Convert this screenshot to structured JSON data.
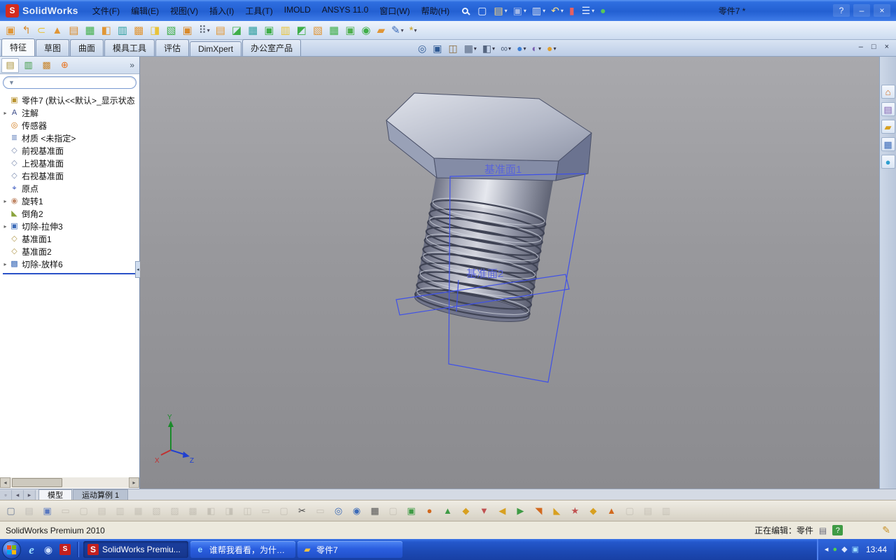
{
  "colors": {
    "titlebar_blue": "#2360d2",
    "taskbar_blue": "#1c49b4",
    "viewport_gray": "#98989c",
    "plane_blue": "#3f51e8",
    "rollback_blue": "#2a52c8",
    "status_help_green": "#3f9b45"
  },
  "titlebar": {
    "logo_letter": "S",
    "logo_text": "SolidWorks",
    "menus": [
      "文件(F)",
      "编辑(E)",
      "视图(V)",
      "插入(I)",
      "工具(T)",
      "IMOLD",
      "ANSYS 11.0",
      "窗口(W)",
      "帮助(H)"
    ],
    "doc_title": "零件7 *",
    "help_label": "?",
    "min_label": "–",
    "close_label": "×"
  },
  "quickbar": [
    {
      "name": "new-document-icon",
      "g": "▢",
      "c": "#f5f8ff",
      "dd": ""
    },
    {
      "name": "open-icon",
      "g": "▤",
      "c": "#ffd879",
      "dd": "▾"
    },
    {
      "name": "save-icon",
      "g": "▣",
      "c": "#9fb6e8",
      "dd": "▾"
    },
    {
      "name": "print-icon",
      "g": "▥",
      "c": "#d8e0f0",
      "dd": "▾"
    },
    {
      "name": "undo-icon",
      "g": "↶",
      "c": "#ffe089",
      "dd": "▾"
    },
    {
      "name": "rebuild-icon",
      "g": "▮",
      "c": "#e86060",
      "dd": ""
    },
    {
      "name": "options-icon",
      "g": "☰",
      "c": "#e8f0ff",
      "dd": "▾"
    },
    {
      "name": "help-sphere-icon",
      "g": "●",
      "c": "#58c858",
      "dd": ""
    }
  ],
  "toolbar2": [
    {
      "name": "imold-tool-1-icon",
      "g": "▣",
      "c": "#e09636",
      "dd": ""
    },
    {
      "name": "imold-tool-2-icon",
      "g": "↰",
      "c": "#d98a2b",
      "dd": ""
    },
    {
      "name": "imold-tool-3-icon",
      "g": "⊂",
      "c": "#e8c33a",
      "dd": ""
    },
    {
      "name": "imold-tool-4-icon",
      "g": "▲",
      "c": "#e09636",
      "dd": ""
    },
    {
      "name": "imold-tool-5-icon",
      "g": "▤",
      "c": "#d98a2b",
      "dd": ""
    },
    {
      "name": "imold-tool-6-icon",
      "g": "▦",
      "c": "#3fae49",
      "dd": ""
    },
    {
      "name": "imold-tool-7-icon",
      "g": "◧",
      "c": "#e09636",
      "dd": ""
    },
    {
      "name": "imold-tool-8-icon",
      "g": "▥",
      "c": "#2f9f9f",
      "dd": ""
    },
    {
      "name": "imold-tool-9-icon",
      "g": "▩",
      "c": "#e09636",
      "dd": ""
    },
    {
      "name": "imold-tool-10-icon",
      "g": "◨",
      "c": "#e8c33a",
      "dd": ""
    },
    {
      "name": "imold-tool-11-icon",
      "g": "▧",
      "c": "#3fae49",
      "dd": ""
    },
    {
      "name": "imold-tool-12-icon",
      "g": "▣",
      "c": "#d98a2b",
      "dd": ""
    },
    {
      "name": "grid-options-icon",
      "g": "⠿",
      "c": "#555f6e",
      "dd": "▾"
    },
    {
      "name": "imold-tool-14-icon",
      "g": "▤",
      "c": "#e09636",
      "dd": ""
    },
    {
      "name": "imold-tool-15-icon",
      "g": "◪",
      "c": "#3fae49",
      "dd": ""
    },
    {
      "name": "imold-tool-16-icon",
      "g": "▦",
      "c": "#2f9f9f",
      "dd": ""
    },
    {
      "name": "imold-tool-17-icon",
      "g": "▣",
      "c": "#3fae49",
      "dd": ""
    },
    {
      "name": "imold-tool-18-icon",
      "g": "▥",
      "c": "#e8c33a",
      "dd": ""
    },
    {
      "name": "imold-tool-19-icon",
      "g": "◩",
      "c": "#3fae49",
      "dd": ""
    },
    {
      "name": "imold-tool-20-icon",
      "g": "▧",
      "c": "#e09636",
      "dd": ""
    },
    {
      "name": "imold-tool-21-icon",
      "g": "▦",
      "c": "#3fae49",
      "dd": ""
    },
    {
      "name": "imold-tool-22-icon",
      "g": "▣",
      "c": "#50b050",
      "dd": ""
    },
    {
      "name": "imold-tool-23-icon",
      "g": "◉",
      "c": "#3fae49",
      "dd": ""
    },
    {
      "name": "imold-tool-24-icon",
      "g": "▰",
      "c": "#e09636",
      "dd": ""
    },
    {
      "name": "sketch-tool-icon",
      "g": "✎",
      "c": "#3a6ab8",
      "dd": "▾"
    },
    {
      "name": "smart-tool-icon",
      "g": "*",
      "c": "#c8a020",
      "dd": "▾"
    }
  ],
  "commandbar": {
    "tabs": [
      {
        "label": "特征",
        "cls": "active"
      },
      {
        "label": "草图",
        "cls": ""
      },
      {
        "label": "曲面",
        "cls": ""
      },
      {
        "label": "模具工具",
        "cls": ""
      },
      {
        "label": "评估",
        "cls": ""
      },
      {
        "label": "DimXpert",
        "cls": ""
      },
      {
        "label": "办公室产品",
        "cls": ""
      }
    ],
    "viewbar": [
      {
        "name": "zoom-fit-icon",
        "g": "◎",
        "c": "#2f5a94",
        "dd": ""
      },
      {
        "name": "zoom-area-icon",
        "g": "▣",
        "c": "#2f5a94",
        "dd": ""
      },
      {
        "name": "section-view-icon",
        "g": "◫",
        "c": "#8a6a3a",
        "dd": ""
      },
      {
        "name": "view-orientation-icon",
        "g": "▦",
        "c": "#55657f",
        "dd": "▾"
      },
      {
        "name": "display-style-icon",
        "g": "◧",
        "c": "#55657f",
        "dd": "▾"
      },
      {
        "name": "hide-show-items-icon",
        "g": "∞",
        "c": "#55657f",
        "dd": "▾"
      },
      {
        "name": "edit-appearance-icon",
        "g": "●",
        "c": "#3d7fd4",
        "dd": "▾"
      },
      {
        "name": "apply-scene-icon",
        "g": "◐",
        "c": "#7a5fb0",
        "dd": "▾"
      },
      {
        "name": "view-settings-icon",
        "g": "●",
        "c": "#e0a030",
        "dd": "▾"
      }
    ],
    "winbtns": [
      {
        "name": "doc-minimize-button",
        "g": "–"
      },
      {
        "name": "doc-restore-button",
        "g": "□"
      },
      {
        "name": "doc-close-button",
        "g": "×"
      }
    ]
  },
  "leftpanel": {
    "pane_tabs": [
      {
        "name": "featuremanager-tab",
        "g": "▤",
        "c": "#a8923c",
        "cls": "on"
      },
      {
        "name": "propertymanager-tab",
        "g": "▥",
        "c": "#3f9b45",
        "cls": ""
      },
      {
        "name": "configurationmanager-tab",
        "g": "▩",
        "c": "#c8862e",
        "cls": ""
      },
      {
        "name": "dimxpertmanager-tab",
        "g": "⊕",
        "c": "#e8731e",
        "cls": ""
      }
    ],
    "chevron": "»",
    "filter_value": "",
    "tree_root": {
      "g": "▣",
      "c": "#b8922e",
      "label": "零件7 (默认<<默认>_显示状态"
    },
    "tree_items": [
      {
        "a": "▸",
        "g": "A",
        "c": "#3a4a88",
        "label": "注解"
      },
      {
        "a": "",
        "g": "◎",
        "c": "#d07818",
        "label": "传感器"
      },
      {
        "a": "",
        "g": "≣",
        "c": "#5878b8",
        "label": "材质 <未指定>"
      },
      {
        "a": "",
        "g": "◇",
        "c": "#7d8db0",
        "label": "前视基准面"
      },
      {
        "a": "",
        "g": "◇",
        "c": "#7d8db0",
        "label": "上视基准面"
      },
      {
        "a": "",
        "g": "◇",
        "c": "#7d8db0",
        "label": "右视基准面"
      },
      {
        "a": "",
        "g": "⌖",
        "c": "#2848b8",
        "label": "原点"
      },
      {
        "a": "▸",
        "g": "◉",
        "c": "#c08868",
        "label": "旋转1"
      },
      {
        "a": "",
        "g": "◣",
        "c": "#8aa33c",
        "label": "倒角2"
      },
      {
        "a": "▸",
        "g": "▣",
        "c": "#3a6ab8",
        "label": "切除-拉伸3"
      },
      {
        "a": "",
        "g": "◇",
        "c": "#b39b52",
        "label": "基准面1"
      },
      {
        "a": "",
        "g": "◇",
        "c": "#b39b52",
        "label": "基准面2"
      },
      {
        "a": "▸",
        "g": "▩",
        "c": "#3a6ab8",
        "label": "切除-放样6"
      }
    ]
  },
  "viewport": {
    "plane1_label": "基准面1",
    "plane2_label": "基准面2",
    "axis_x": "X",
    "axis_y": "Y",
    "axis_z": "Z"
  },
  "taskpane_icons": [
    {
      "name": "solidworks-resources-icon",
      "g": "⌂",
      "c": "#d3691e"
    },
    {
      "name": "design-library-icon",
      "g": "▤",
      "c": "#7f5fb0"
    },
    {
      "name": "file-explorer-icon",
      "g": "▰",
      "c": "#d8a020"
    },
    {
      "name": "view-palette-icon",
      "g": "▦",
      "c": "#3a6ab8"
    },
    {
      "name": "appearances-icon",
      "g": "●",
      "c": "#2e9fd0"
    }
  ],
  "modeltabs": {
    "nav": [
      {
        "name": "pane-splitter-icon",
        "g": "▫"
      },
      {
        "name": "tab-scroll-left-icon",
        "g": "◂"
      },
      {
        "name": "tab-scroll-right-icon",
        "g": "▸"
      }
    ],
    "tabs": [
      {
        "label": "模型",
        "cls": "active"
      },
      {
        "label": "运动算例 1",
        "cls": ""
      }
    ]
  },
  "bottombar": [
    {
      "g": "▢",
      "c": "#6a7a95",
      "cls": ""
    },
    {
      "g": "▤",
      "c": "#8a8a8a",
      "cls": "mut"
    },
    {
      "g": "▣",
      "c": "#5a79c0",
      "cls": ""
    },
    {
      "g": "▭",
      "c": "#9a958a",
      "cls": "mut"
    },
    {
      "g": "▢",
      "c": "#9a958a",
      "cls": "mut"
    },
    {
      "g": "▤",
      "c": "#9a958a",
      "cls": "mut"
    },
    {
      "g": "▥",
      "c": "#9a958a",
      "cls": "mut"
    },
    {
      "g": "▦",
      "c": "#9a958a",
      "cls": "mut"
    },
    {
      "g": "▧",
      "c": "#9a958a",
      "cls": "mut"
    },
    {
      "g": "▨",
      "c": "#9a958a",
      "cls": "mut"
    },
    {
      "g": "▩",
      "c": "#9a958a",
      "cls": "mut"
    },
    {
      "g": "◧",
      "c": "#9a958a",
      "cls": "mut"
    },
    {
      "g": "◨",
      "c": "#9a958a",
      "cls": "mut"
    },
    {
      "g": "◫",
      "c": "#9a958a",
      "cls": "mut"
    },
    {
      "g": "▭",
      "c": "#9a958a",
      "cls": "mut"
    },
    {
      "g": "▢",
      "c": "#9a958a",
      "cls": "mut"
    },
    {
      "g": "✂",
      "c": "#444444",
      "cls": ""
    },
    {
      "g": "▭",
      "c": "#9a958a",
      "cls": "mut"
    },
    {
      "g": "◎",
      "c": "#3a6ab8",
      "cls": ""
    },
    {
      "g": "◉",
      "c": "#3a6ab8",
      "cls": ""
    },
    {
      "g": "▦",
      "c": "#555555",
      "cls": ""
    },
    {
      "g": "▢",
      "c": "#9a958a",
      "cls": "mut"
    },
    {
      "g": "▣",
      "c": "#3f9b45",
      "cls": ""
    },
    {
      "g": "●",
      "c": "#d2691e",
      "cls": ""
    },
    {
      "g": "▲",
      "c": "#3f9b45",
      "cls": ""
    },
    {
      "g": "◆",
      "c": "#d8a020",
      "cls": ""
    },
    {
      "g": "▼",
      "c": "#c05050",
      "cls": ""
    },
    {
      "g": "◀",
      "c": "#d8a020",
      "cls": ""
    },
    {
      "g": "▶",
      "c": "#3f9b45",
      "cls": ""
    },
    {
      "g": "◥",
      "c": "#d2691e",
      "cls": ""
    },
    {
      "g": "◣",
      "c": "#d8a020",
      "cls": ""
    },
    {
      "g": "★",
      "c": "#c05050",
      "cls": ""
    },
    {
      "g": "◆",
      "c": "#d8a020",
      "cls": ""
    },
    {
      "g": "▲",
      "c": "#d2691e",
      "cls": ""
    },
    {
      "g": "▢",
      "c": "#9a958a",
      "cls": "mut"
    },
    {
      "g": "▤",
      "c": "#9a958a",
      "cls": "mut"
    },
    {
      "g": "▥",
      "c": "#9a958a",
      "cls": "mut"
    }
  ],
  "statusbar": {
    "product": "SolidWorks Premium 2010",
    "editing": "正在编辑：零件",
    "doc_icon": "▤",
    "help_icon": "?",
    "pencil_icon": "✎"
  },
  "taskbar": {
    "quick": [
      {
        "name": "internet-explorer-icon",
        "g": "e",
        "c": "#9adcff",
        "cls": "ie"
      },
      {
        "name": "media-icon",
        "g": "◉",
        "c": "#cfe0ff",
        "cls": ""
      },
      {
        "name": "solidworks-quick-icon",
        "g": "S",
        "c": "#ffffff",
        "cls": "sw"
      }
    ],
    "tasks": [
      {
        "name": "task-solidworks",
        "ig": "S",
        "ic": "#ffffff",
        "ibg": "#c22020",
        "label": "SolidWorks Premiu...",
        "cls": "active"
      },
      {
        "name": "task-browser",
        "ig": "e",
        "ic": "#9adcff",
        "ibg": "",
        "label": "谁帮我看看，为什么...",
        "cls": ""
      },
      {
        "name": "task-folder",
        "ig": "▰",
        "ic": "#f0c040",
        "ibg": "",
        "label": "零件7",
        "cls": ""
      }
    ],
    "tray": [
      {
        "name": "tray-hide-icon",
        "g": "◂",
        "c": "#eaf2ff"
      },
      {
        "name": "tray-status-icon",
        "g": "●",
        "c": "#50d050"
      },
      {
        "name": "tray-volume-icon",
        "g": "◆",
        "c": "#d8e4ff"
      },
      {
        "name": "tray-network-icon",
        "g": "▣",
        "c": "#9adcff"
      }
    ],
    "time": "13:44"
  }
}
